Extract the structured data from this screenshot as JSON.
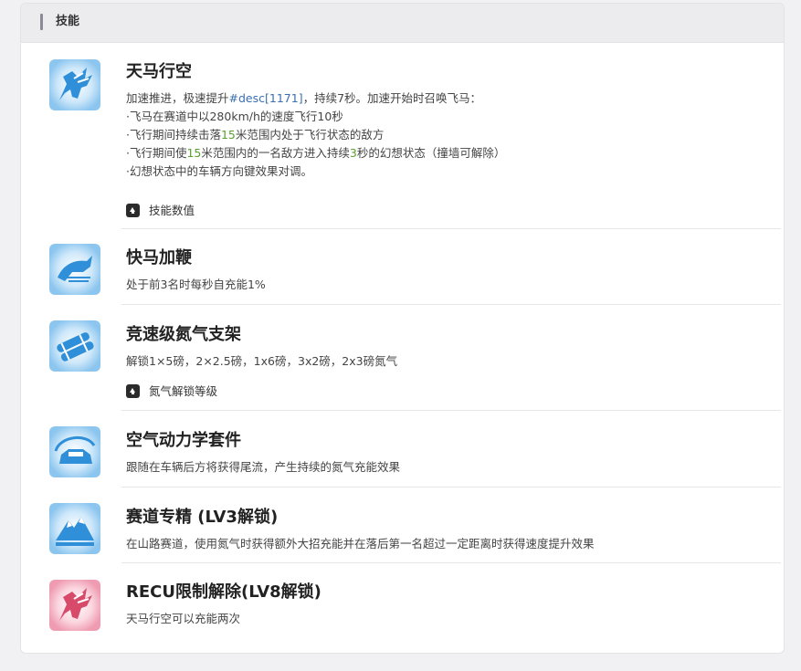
{
  "section": {
    "title": "技能"
  },
  "skills": [
    {
      "name": "天马行空",
      "icon": "flying-horse-icon",
      "color": "#2f8fd8",
      "desc_lines": [
        [
          {
            "t": "加速推进，极速提升"
          },
          {
            "t": "#desc[1171]",
            "c": "link"
          },
          {
            "t": "，持续7秒。加速开始时召唤飞马："
          }
        ],
        [
          {
            "t": "·飞马在赛道中以280km/h的速度飞行10秒"
          }
        ],
        [
          {
            "t": "·飞行期间持续击落"
          },
          {
            "t": "15",
            "c": "num"
          },
          {
            "t": "米范围内处于飞行状态的敌方"
          }
        ],
        [
          {
            "t": "·飞行期间使"
          },
          {
            "t": "15",
            "c": "num"
          },
          {
            "t": "米范围内的一名敌方进入持续"
          },
          {
            "t": "3",
            "c": "num"
          },
          {
            "t": "秒的幻想状态（撞墙可解除）"
          }
        ],
        [
          {
            "t": "·幻想状态中的车辆方向键效果对调。"
          }
        ]
      ],
      "toggle": "技能数值"
    },
    {
      "name": "快马加鞭",
      "icon": "galloping-horse-icon",
      "color": "#2f8fd8",
      "desc_lines": [
        [
          {
            "t": "处于前3名时每秒自充能1%"
          }
        ]
      ]
    },
    {
      "name": "竞速级氮气支架",
      "icon": "nitro-tanks-icon",
      "color": "#2f8fd8",
      "desc_lines": [
        [
          {
            "t": "解锁1×5磅，2×2.5磅，1x6磅，3x2磅，2x3磅氮气"
          }
        ]
      ],
      "toggle": "氮气解锁等级"
    },
    {
      "name": "空气动力学套件",
      "icon": "aero-car-icon",
      "color": "#2f8fd8",
      "desc_lines": [
        [
          {
            "t": "跟随在车辆后方将获得尾流，产生持续的氮气充能效果"
          }
        ]
      ]
    },
    {
      "name": "赛道专精 (LV3解锁)",
      "icon": "mountain-icon",
      "color": "#2f8fd8",
      "desc_lines": [
        [
          {
            "t": "在山路赛道，使用氮气时获得额外大招充能并在落后第一名超过一定距离时获得速度提升效果"
          }
        ]
      ]
    },
    {
      "name": "RECU限制解除(LV8解锁)",
      "icon": "flying-horse-red-icon",
      "color": "#d84a6a",
      "desc_lines": [
        [
          {
            "t": "天马行空可以充能两次"
          }
        ]
      ]
    }
  ]
}
